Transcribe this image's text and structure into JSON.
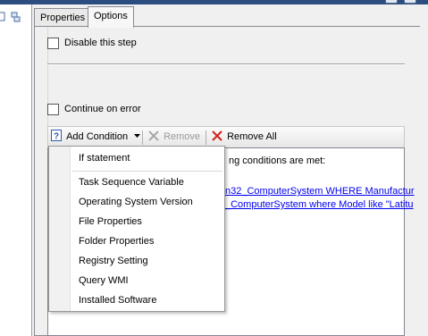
{
  "tabs": [
    {
      "label": "Properties"
    },
    {
      "label": "Options"
    }
  ],
  "options": {
    "disable_step_label": "Disable this step",
    "continue_on_error_label": "Continue on error"
  },
  "toolbar": {
    "add_condition_label": "Add Condition",
    "remove_label": "Remove",
    "remove_all_label": "Remove All"
  },
  "conditions": {
    "header_fragment": "ng conditions are met:",
    "link1_fragment": "n32_ComputerSystem WHERE Manufactur",
    "link2_fragment": "_ComputerSystem where Model like \"Latitu"
  },
  "menu": {
    "items": [
      {
        "label": "If statement"
      },
      {
        "label": "Task Sequence Variable"
      },
      {
        "label": "Operating System Version"
      },
      {
        "label": "File Properties"
      },
      {
        "label": "Folder Properties"
      },
      {
        "label": "Registry Setting"
      },
      {
        "label": "Query WMI"
      },
      {
        "label": "Installed Software"
      }
    ]
  },
  "colors": {
    "link": "#0000ee",
    "remove_all_x": "#d0201a",
    "help_icon": "#2a5db0",
    "disabled_text": "#9a9a9a"
  },
  "icons": [
    "help-icon",
    "dropdown-arrow-icon",
    "remove-x-icon",
    "remove-all-x-icon"
  ]
}
